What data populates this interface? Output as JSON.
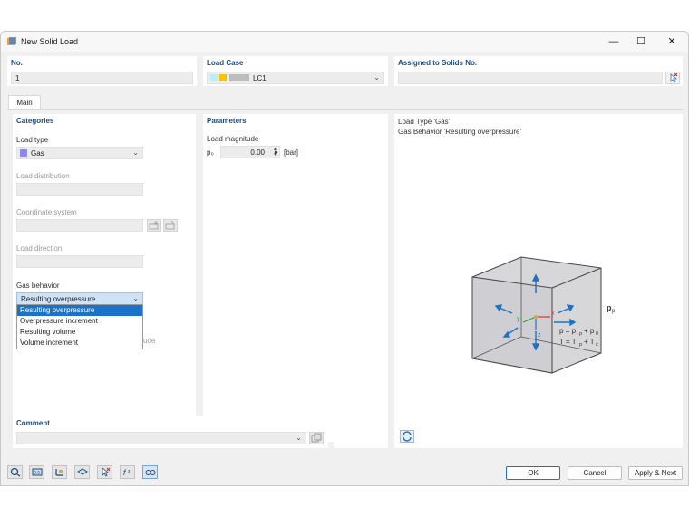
{
  "window": {
    "title": "New Solid Load",
    "minimize": "—",
    "maximize": "☐",
    "close": "✕"
  },
  "header": {
    "no_label": "No.",
    "no_value": "1",
    "load_case_label": "Load Case",
    "load_case_value": "LC1",
    "assigned_label": "Assigned to Solids No.",
    "assigned_value": ""
  },
  "tabs": [
    {
      "label": "Main"
    }
  ],
  "categories": {
    "title": "Categories",
    "load_type_label": "Load type",
    "load_type_value": "Gas",
    "load_distribution_label": "Load distribution",
    "coordinate_system_label": "Coordinate system",
    "load_direction_label": "Load direction",
    "gas_behavior_label": "Gas behavior",
    "gas_behavior_value": "Resulting overpressure",
    "hidden_text": "itude",
    "gas_behavior_options": [
      "Resulting overpressure",
      "Overpressure increment",
      "Resulting volume",
      "Volume increment"
    ]
  },
  "parameters": {
    "title": "Parameters",
    "load_magnitude_label": "Load magnitude",
    "symbol": "p₀",
    "value": "0.00",
    "unit": "[bar]"
  },
  "info": {
    "line1": "Load Type 'Gas'",
    "line2": "Gas Behavior 'Resulting overpressure'",
    "diagram": {
      "label_pp": "p",
      "label_pp_sub": "p",
      "eq1": "p = p",
      "eq1_a": "p",
      "eq1_b": "+ p",
      "eq1_c": "0",
      "eq2": "T = T",
      "eq2_a": "p",
      "eq2_b": "+ T",
      "eq2_c": "c",
      "axis_x": "x",
      "axis_y": "y",
      "axis_z": "z"
    }
  },
  "comment": {
    "label": "Comment",
    "value": ""
  },
  "buttons": {
    "ok": "OK",
    "cancel": "Cancel",
    "apply_next": "Apply & Next"
  },
  "colors": {
    "accent": "#1b4c7f",
    "selection": "#1a73c8",
    "gas_swatch": "#8f86f0",
    "lc_yellow": "#f5c400",
    "lc_cyan": "#b9f0f5"
  }
}
